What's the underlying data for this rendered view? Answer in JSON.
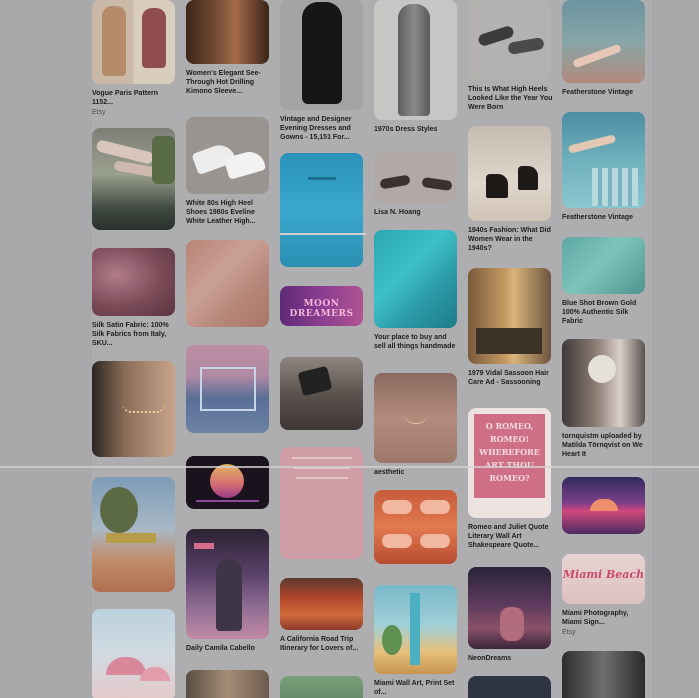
{
  "pins": {
    "vogue_pattern": {
      "title": "Vogue Paris Pattern 1152...",
      "source": "Etsy"
    },
    "kimono_sleeve": {
      "title": "Women's Elegant See-Through Hot Drilling Kimono Sleeve..."
    },
    "vintage_dresses": {
      "title": "Vintage and Designer Evening Dresses and Gowns - 15,151 For..."
    },
    "dress_styles_1970s": {
      "title": "1970s Dress Styles"
    },
    "high_heels": {
      "title": "This Is What High Heels Looked Like the Year You Were Born"
    },
    "featherstone_1": {
      "title": "Featherstone Vintage"
    },
    "white_heels": {
      "title": "White 80s High Heel Shoes 1980s Eveline White Leather High..."
    },
    "lisa_hoang": {
      "title": "Lisa N. Hoang"
    },
    "fashion_1940s": {
      "title": "1940s Fashion: What Did Women Wear in the 1940s?"
    },
    "featherstone_2": {
      "title": "Featherstone Vintage"
    },
    "silk_fabric": {
      "title": "Silk Satin Fabric: 100% Silk Fabrics from Italy, SKU..."
    },
    "moon_dreamers": {
      "art_text": "MOON DREAMERS"
    },
    "buy_and_sell": {
      "title": "Your place to buy and sell all things handmade"
    },
    "sassoon_ad": {
      "title": "1979 Vidal Sassoon Hair Care Ad - Sassooning"
    },
    "blue_silk": {
      "title": "Blue Shot Brown Gold 100% Authentic Silk Fabric"
    },
    "tornquistm": {
      "title": "tornquistm uploaded by Matilda Törnqvist on We Heart It"
    },
    "aesthetic": {
      "title": "aesthetic"
    },
    "romeo_quote": {
      "title": "Romeo and Juliet Quote Literary Wall Art Shakespeare Quote...",
      "art_text": [
        "O ROMEO,",
        "ROMEO!",
        "WHEREFORE",
        "ART THOU",
        "ROMEO?"
      ]
    },
    "camila": {
      "title": "Daily Camila Cabello"
    },
    "road_trip": {
      "title": "A California Road Trip Itinerary for Lovers of..."
    },
    "miami_art": {
      "title": "Miami Wall Art, Print Set of..."
    },
    "neon_dreams": {
      "title": "NeonDreams"
    },
    "miami_photo": {
      "title": "Miami Photography, Miami Sign...",
      "source": "Etsy",
      "art_text": "Miami Beach"
    }
  },
  "colors": {
    "page_background": "#a9a9ab",
    "caption_text": "#1e1e1e",
    "source_text": "#4d4d4d"
  }
}
